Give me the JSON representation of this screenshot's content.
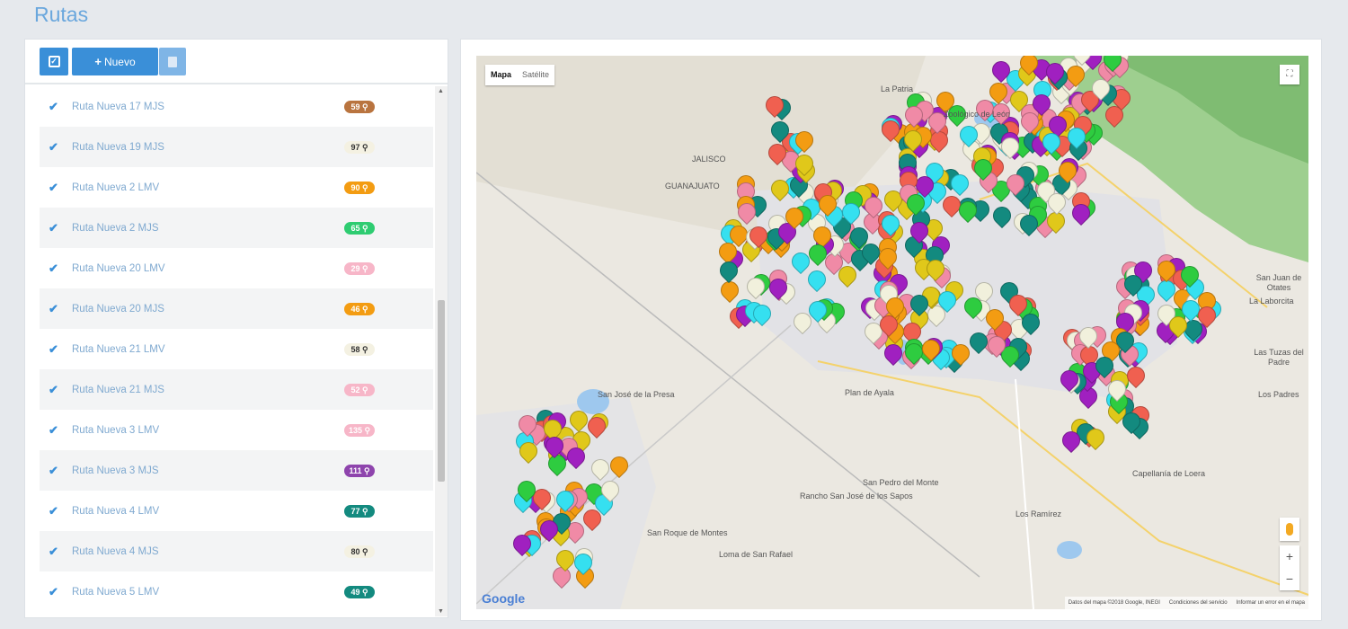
{
  "page": {
    "title": "Rutas"
  },
  "toolbar": {
    "new_label": "Nuevo"
  },
  "routes": [
    {
      "label": "Ruta Nueva 17 MJS",
      "badge": "59 ⚲",
      "color": "#b9743f",
      "dark": false
    },
    {
      "label": "Ruta Nueva 19 MJS",
      "badge": "97 ⚲",
      "color": "#f4f1e2",
      "dark": true
    },
    {
      "label": "Ruta Nueva 2 LMV",
      "badge": "90 ⚲",
      "color": "#f39c12",
      "dark": false
    },
    {
      "label": "Ruta Nueva 2 MJS",
      "badge": "65 ⚲",
      "color": "#2ecc71",
      "dark": false
    },
    {
      "label": "Ruta Nueva 20 LMV",
      "badge": "29 ⚲",
      "color": "#f7b6c8",
      "dark": false
    },
    {
      "label": "Ruta Nueva 20 MJS",
      "badge": "46 ⚲",
      "color": "#f39c12",
      "dark": false
    },
    {
      "label": "Ruta Nueva 21 LMV",
      "badge": "58 ⚲",
      "color": "#f4f1e2",
      "dark": true
    },
    {
      "label": "Ruta Nueva 21 MJS",
      "badge": "52 ⚲",
      "color": "#f7b6c8",
      "dark": false
    },
    {
      "label": "Ruta Nueva 3 LMV",
      "badge": "135 ⚲",
      "color": "#f7b6c8",
      "dark": false
    },
    {
      "label": "Ruta Nueva 3 MJS",
      "badge": "111 ⚲",
      "color": "#8e44ad",
      "dark": false
    },
    {
      "label": "Ruta Nueva 4 LMV",
      "badge": "77 ⚲",
      "color": "#138a7f",
      "dark": false
    },
    {
      "label": "Ruta Nueva 4 MJS",
      "badge": "80 ⚲",
      "color": "#f4f1e2",
      "dark": true
    },
    {
      "label": "Ruta Nueva 5 LMV",
      "badge": "49 ⚲",
      "color": "#138a7f",
      "dark": false
    }
  ],
  "map": {
    "type_buttons": [
      "Mapa",
      "Satélite"
    ],
    "google_label": "Google",
    "attribution": [
      "Datos del mapa ©2018 Google, INEGI",
      "Condiciones del servicio",
      "Informar un error en el mapa"
    ],
    "places": [
      "La Patria",
      "Zoológico de León",
      "San José de la Presa",
      "Plan de Ayala",
      "San Pedro del Monte",
      "Rancho San José de los Sapos",
      "San Roque de Montes",
      "Loma de San Rafael",
      "Los Ramírez",
      "Capellanía de Loera",
      "San Juan de Otates",
      "La Laborcita",
      "Las Tuzas del Padre",
      "Los Padres",
      "GUANAJUATO",
      "JALISCO"
    ],
    "icons": {
      "fullscreen": "fullscreen-icon",
      "pegman": "pegman-icon",
      "zoom_in": "+",
      "zoom_out": "−"
    }
  },
  "colors": {
    "accent": "#3a8fd8",
    "title": "#6aa7dd",
    "teal": "#138a7f",
    "pink": "#f08aa6",
    "purple": "#a020c0",
    "yellow": "#e0c81a",
    "orange": "#f39c12",
    "cyan": "#35e0f0",
    "green": "#2ecc40",
    "cream": "#f1f0dc",
    "red": "#f06050"
  }
}
